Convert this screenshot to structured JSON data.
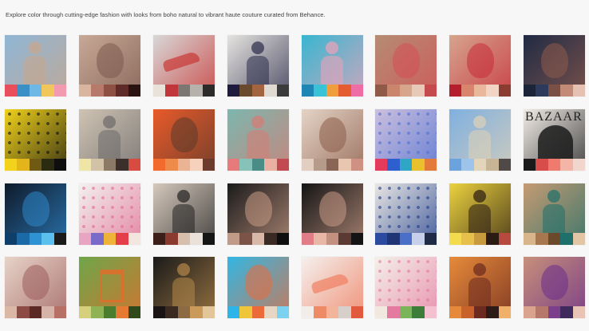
{
  "intro": "Explore color through cutting-edge fashion with looks from boho natural to vibrant haute couture curated from Behance.",
  "gallery": [
    {
      "subject": "woman-in-boho-outfit",
      "bg": "#8fb6d6",
      "accent": "#c9a58a",
      "icon": "person",
      "palette": [
        "#e94f5a",
        "#3a8fc4",
        "#6fb8e6",
        "#f1c65a",
        "#f19ab0"
      ]
    },
    {
      "subject": "beauty-closeup-gold-glitter",
      "bg": "#c8a996",
      "accent": "#7b5a4e",
      "icon": "face",
      "palette": [
        "#d9b59f",
        "#b77a6a",
        "#8e4f45",
        "#5e2b28",
        "#2a1412"
      ]
    },
    {
      "subject": "shoes-still-life",
      "bg": "#d8d8d8",
      "accent": "#c7302d",
      "icon": "shoe",
      "palette": [
        "#e8e2da",
        "#c0363a",
        "#7d7774",
        "#b7b1ab",
        "#2d2a2a"
      ]
    },
    {
      "subject": "man-in-patterned-shirt",
      "bg": "#e6e4e0",
      "accent": "#2b2b4a",
      "icon": "person",
      "palette": [
        "#1f1b3f",
        "#6a4a2e",
        "#a3653f",
        "#e0dad3",
        "#3b3b3b"
      ]
    },
    {
      "subject": "woman-at-pool",
      "bg": "#38b6d1",
      "accent": "#f0a3b8",
      "icon": "person",
      "palette": [
        "#1e86b4",
        "#38c3d6",
        "#f09d3c",
        "#e55d2f",
        "#ee6da5"
      ]
    },
    {
      "subject": "woman-with-sunglasses",
      "bg": "#b58d73",
      "accent": "#d34f55",
      "icon": "face",
      "palette": [
        "#8f5b48",
        "#c9866c",
        "#d6a58c",
        "#e8c9b7",
        "#c44a4e"
      ]
    },
    {
      "subject": "woman-red-lips",
      "bg": "#d6a48c",
      "accent": "#c62b38",
      "icon": "face",
      "palette": [
        "#b51e2c",
        "#d9856e",
        "#e8b79c",
        "#f1d4c4",
        "#8a3c30"
      ]
    },
    {
      "subject": "woman-with-earrings",
      "bg": "#1f2a44",
      "accent": "#8e5b4d",
      "icon": "face",
      "palette": [
        "#1b2438",
        "#2d3a5b",
        "#7a5045",
        "#c38a78",
        "#e6c1b1"
      ]
    },
    {
      "subject": "yellow-pattern",
      "bg": "#f0d21c",
      "accent": "#111111",
      "icon": "pattern",
      "palette": [
        "#f2d21a",
        "#e3b51b",
        "#6e5a13",
        "#2a2b10",
        "#0e0e0e"
      ]
    },
    {
      "subject": "man-in-grey-suit",
      "bg": "#cfc3b3",
      "accent": "#6c6a6a",
      "icon": "person",
      "palette": [
        "#efe6a6",
        "#d2c2a6",
        "#8d7a66",
        "#3a2f2b",
        "#d84b41"
      ]
    },
    {
      "subject": "woman-on-orange",
      "bg": "#e85a2a",
      "accent": "#5b3a2c",
      "icon": "face",
      "palette": [
        "#f36b2c",
        "#ee8a4a",
        "#e9b394",
        "#f6d2bd",
        "#6d3b2c"
      ]
    },
    {
      "subject": "two-women-teal",
      "bg": "#7cb7ae",
      "accent": "#d77b73",
      "icon": "person",
      "palette": [
        "#e77a7a",
        "#86c2b8",
        "#4a8d86",
        "#eab0a2",
        "#c24b52"
      ]
    },
    {
      "subject": "woman-with-scarf",
      "bg": "#e4d4c6",
      "accent": "#8d5d4b",
      "icon": "face",
      "palette": [
        "#e3cfc2",
        "#b79b8a",
        "#8a6555",
        "#e8c6b0",
        "#cf9282"
      ]
    },
    {
      "subject": "jeweled-rings",
      "bg": "#ccc0de",
      "accent": "#4f6fd0",
      "icon": "pattern",
      "palette": [
        "#e43a5b",
        "#2d5fcf",
        "#2fa6c6",
        "#e9c12d",
        "#e47a3a"
      ]
    },
    {
      "subject": "figure-in-desert",
      "bg": "#7fb0e0",
      "accent": "#e0d1b6",
      "icon": "person",
      "palette": [
        "#6aa3dd",
        "#9fc4ea",
        "#e3d5ba",
        "#c8b596",
        "#4f4a47"
      ]
    },
    {
      "subject": "bazaar-magazine",
      "bg": "#f1ece7",
      "accent": "#1b1b1b",
      "icon": "magazine",
      "label": "BAZAAR",
      "palette": [
        "#1a1a1a",
        "#d84c4a",
        "#ee7b6d",
        "#f4b5a6",
        "#f0d6cd"
      ]
    },
    {
      "subject": "blue-painted-face",
      "bg": "#0f1a2b",
      "accent": "#2f86c9",
      "icon": "face",
      "palette": [
        "#0e3f6b",
        "#1b6aa8",
        "#2f93d3",
        "#5cc0ef",
        "#1a1a1a"
      ]
    },
    {
      "subject": "sweets-flatlay",
      "bg": "#f3f1f0",
      "accent": "#e06a8f",
      "icon": "pattern",
      "palette": [
        "#e7a5c2",
        "#7a6ac9",
        "#f0b33a",
        "#e43e4b",
        "#f3e6de"
      ]
    },
    {
      "subject": "checkered-floor",
      "bg": "#d6c9bd",
      "accent": "#222222",
      "icon": "person",
      "palette": [
        "#3d1f1a",
        "#8a3a2e",
        "#d7bfae",
        "#eae2da",
        "#151515"
      ]
    },
    {
      "subject": "woman-with-piercings",
      "bg": "#1b1b1b",
      "accent": "#c89b85",
      "icon": "face",
      "palette": [
        "#c29a88",
        "#7b5447",
        "#d8b8a8",
        "#3a2a26",
        "#0e0e0e"
      ]
    },
    {
      "subject": "woman-dark-hair",
      "bg": "#151515",
      "accent": "#c89a86",
      "icon": "face",
      "palette": [
        "#e07d86",
        "#e9b7a8",
        "#c4907f",
        "#5a3a32",
        "#141414"
      ]
    },
    {
      "subject": "patches-packaging",
      "bg": "#e9e7e4",
      "accent": "#1d3b8a",
      "icon": "pattern",
      "palette": [
        "#2c4b9f",
        "#203575",
        "#4a6fc8",
        "#c6d0e8",
        "#1f2a44"
      ]
    },
    {
      "subject": "figure-on-yellow",
      "bg": "#ecd33f",
      "accent": "#2a1b14",
      "icon": "person",
      "palette": [
        "#f2db4c",
        "#e6c04a",
        "#c79b3d",
        "#2a1b14",
        "#b64a3e"
      ]
    },
    {
      "subject": "woman-on-sofa",
      "bg": "#c59b73",
      "accent": "#1e6f6a",
      "icon": "person",
      "palette": [
        "#d9b58c",
        "#a7774f",
        "#6b4a2c",
        "#1f6f6a",
        "#e2c5a4"
      ]
    },
    {
      "subject": "woman-in-floral",
      "bg": "#e7d3c9",
      "accent": "#9c5d5b",
      "icon": "face",
      "palette": [
        "#dbb7a6",
        "#8c4b44",
        "#5c2a25",
        "#d6b3a7",
        "#b77066"
      ]
    },
    {
      "subject": "chair-on-grass",
      "bg": "#6ea64a",
      "accent": "#e56a2a",
      "icon": "chair",
      "palette": [
        "#d6cf7c",
        "#8eb254",
        "#4a7d2e",
        "#e67a33",
        "#2e4a1c"
      ]
    },
    {
      "subject": "leopard-dress",
      "bg": "#1a1a1a",
      "accent": "#b5884a",
      "icon": "person",
      "palette": [
        "#1a1514",
        "#3a2a20",
        "#8c6a44",
        "#c99a5a",
        "#e2c699"
      ]
    },
    {
      "subject": "colorful-makeup",
      "bg": "#32b7e3",
      "accent": "#ec6a3a",
      "icon": "face",
      "palette": [
        "#2db4e8",
        "#efc53a",
        "#ec6a3a",
        "#e8d6c4",
        "#7bd2f0"
      ]
    },
    {
      "subject": "white-sneakers",
      "bg": "#f4f0ee",
      "accent": "#ef7a5a",
      "icon": "shoe",
      "palette": [
        "#f2ede9",
        "#ef8a66",
        "#f3b49c",
        "#d7cfc9",
        "#e25a3e"
      ]
    },
    {
      "subject": "floral-print",
      "bg": "#f4f1ea",
      "accent": "#e57aa0",
      "icon": "pattern",
      "palette": [
        "#f1e8e0",
        "#e57aa0",
        "#7bb55a",
        "#3d7d3a",
        "#f3c1cf"
      ]
    },
    {
      "subject": "woman-in-hat",
      "bg": "#e78a3a",
      "accent": "#6b2a1f",
      "icon": "person",
      "palette": [
        "#e5893a",
        "#c9622a",
        "#6d2a1e",
        "#2c1b16",
        "#f0b06a"
      ]
    },
    {
      "subject": "glitter-lips",
      "bg": "#c78f7a",
      "accent": "#6a2d8a",
      "icon": "face",
      "palette": [
        "#d9a38d",
        "#b5786a",
        "#7b3f8c",
        "#3e2a5c",
        "#e9c3b3"
      ]
    }
  ]
}
